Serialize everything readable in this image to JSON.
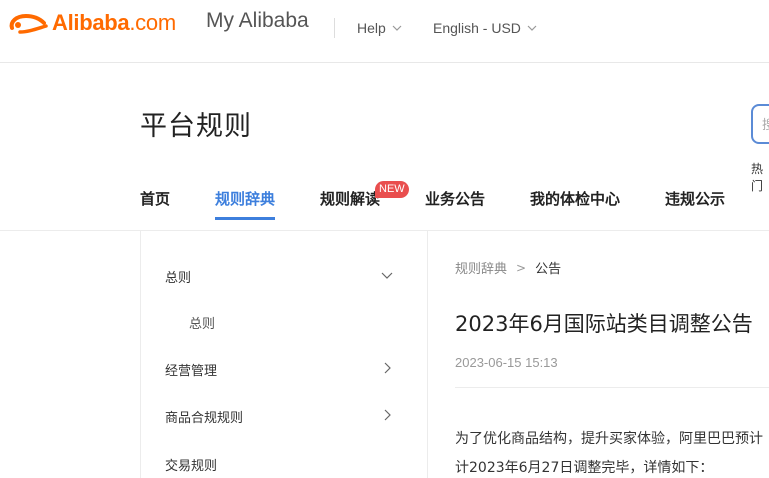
{
  "topbar": {
    "logo_brand": "Alibaba",
    "logo_suffix": ".com",
    "product": "My Alibaba",
    "help_label": "Help",
    "language_label": "English - USD"
  },
  "page": {
    "title": "平台规则",
    "search_hint": "搜",
    "hot_label": "热门"
  },
  "nav": {
    "items": [
      {
        "label": "首页"
      },
      {
        "label": "规则辞典"
      },
      {
        "label": "规则解读"
      },
      {
        "label": "业务公告"
      },
      {
        "label": "我的体检中心"
      },
      {
        "label": "违规公示"
      }
    ],
    "active_index": 1,
    "new_badge": "NEW"
  },
  "sidebar": {
    "items": [
      {
        "label": "总则"
      },
      {
        "label": "总则"
      },
      {
        "label": "经营管理"
      },
      {
        "label": "商品合规规则"
      },
      {
        "label": "交易规则"
      }
    ]
  },
  "breadcrumb": {
    "root": "规则辞典",
    "separator": ">",
    "current": "公告"
  },
  "article": {
    "title": "2023年6月国际站类目调整公告",
    "date": "2023-06-15 15:13",
    "para_line1": "为了优化商品结构，提升买家体验，阿里巴巴预计",
    "para_line2": "计2023年6月27日调整完毕，详情如下："
  },
  "colors": {
    "brand": "#ff6a00",
    "accent": "#3d7fdd",
    "badge": "#e94e4e"
  }
}
